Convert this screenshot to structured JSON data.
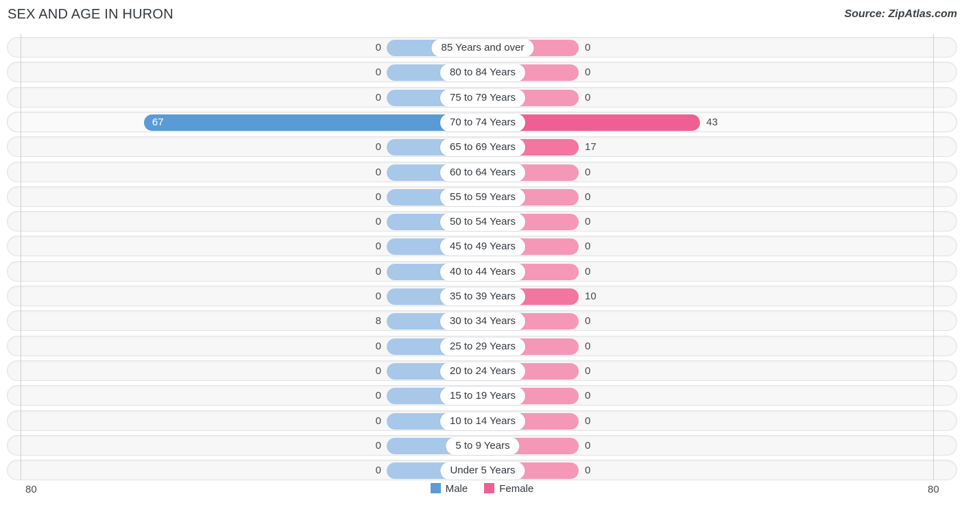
{
  "header": {
    "title": "SEX AND AGE IN HURON",
    "source": "Source: ZipAtlas.com"
  },
  "legend": {
    "male_label": "Male",
    "female_label": "Female",
    "male_color": "#5a9bd5",
    "female_color": "#ef5f93"
  },
  "axis": {
    "left_tick": "80",
    "right_tick": "80"
  },
  "colors": {
    "male_light": "#a8c8ea",
    "male_strong": "#5a9bd5",
    "female_light": "#f598b8",
    "female_mid": "#f2769f",
    "female_strong": "#ef5f93",
    "row_background": "#f7f7f7",
    "row_border": "#e3e3e3",
    "title_text": "#33393f"
  },
  "chart_data": {
    "type": "bar",
    "subtype": "population-pyramid",
    "title": "SEX AND AGE IN HURON",
    "xlabel": "",
    "ylabel": "",
    "xlim": [
      -80,
      80
    ],
    "grid": false,
    "legend_position": "bottom-center",
    "categories": [
      "85 Years and over",
      "80 to 84 Years",
      "75 to 79 Years",
      "70 to 74 Years",
      "65 to 69 Years",
      "60 to 64 Years",
      "55 to 59 Years",
      "50 to 54 Years",
      "45 to 49 Years",
      "40 to 44 Years",
      "35 to 39 Years",
      "30 to 34 Years",
      "25 to 29 Years",
      "20 to 24 Years",
      "15 to 19 Years",
      "10 to 14 Years",
      "5 to 9 Years",
      "Under 5 Years"
    ],
    "series": [
      {
        "name": "Male",
        "color": "#5a9bd5",
        "values": [
          0,
          0,
          0,
          67,
          0,
          0,
          0,
          0,
          0,
          0,
          0,
          8,
          0,
          0,
          0,
          0,
          0,
          0
        ]
      },
      {
        "name": "Female",
        "color": "#ef5f93",
        "values": [
          0,
          0,
          0,
          43,
          17,
          0,
          0,
          0,
          0,
          0,
          10,
          0,
          0,
          0,
          0,
          0,
          0,
          0
        ]
      }
    ]
  },
  "rows": [
    {
      "label": "85 Years and over",
      "male": "0",
      "female": "0",
      "male_val": 0,
      "female_val": 0
    },
    {
      "label": "80 to 84 Years",
      "male": "0",
      "female": "0",
      "male_val": 0,
      "female_val": 0
    },
    {
      "label": "75 to 79 Years",
      "male": "0",
      "female": "0",
      "male_val": 0,
      "female_val": 0
    },
    {
      "label": "70 to 74 Years",
      "male": "67",
      "female": "43",
      "male_val": 67,
      "female_val": 43
    },
    {
      "label": "65 to 69 Years",
      "male": "0",
      "female": "17",
      "male_val": 0,
      "female_val": 17
    },
    {
      "label": "60 to 64 Years",
      "male": "0",
      "female": "0",
      "male_val": 0,
      "female_val": 0
    },
    {
      "label": "55 to 59 Years",
      "male": "0",
      "female": "0",
      "male_val": 0,
      "female_val": 0
    },
    {
      "label": "50 to 54 Years",
      "male": "0",
      "female": "0",
      "male_val": 0,
      "female_val": 0
    },
    {
      "label": "45 to 49 Years",
      "male": "0",
      "female": "0",
      "male_val": 0,
      "female_val": 0
    },
    {
      "label": "40 to 44 Years",
      "male": "0",
      "female": "0",
      "male_val": 0,
      "female_val": 0
    },
    {
      "label": "35 to 39 Years",
      "male": "0",
      "female": "10",
      "male_val": 0,
      "female_val": 10
    },
    {
      "label": "30 to 34 Years",
      "male": "8",
      "female": "0",
      "male_val": 8,
      "female_val": 0
    },
    {
      "label": "25 to 29 Years",
      "male": "0",
      "female": "0",
      "male_val": 0,
      "female_val": 0
    },
    {
      "label": "20 to 24 Years",
      "male": "0",
      "female": "0",
      "male_val": 0,
      "female_val": 0
    },
    {
      "label": "15 to 19 Years",
      "male": "0",
      "female": "0",
      "male_val": 0,
      "female_val": 0
    },
    {
      "label": "10 to 14 Years",
      "male": "0",
      "female": "0",
      "male_val": 0,
      "female_val": 0
    },
    {
      "label": "5 to 9 Years",
      "male": "0",
      "female": "0",
      "male_val": 0,
      "female_val": 0
    },
    {
      "label": "Under 5 Years",
      "male": "0",
      "female": "0",
      "male_val": 0,
      "female_val": 0
    }
  ]
}
